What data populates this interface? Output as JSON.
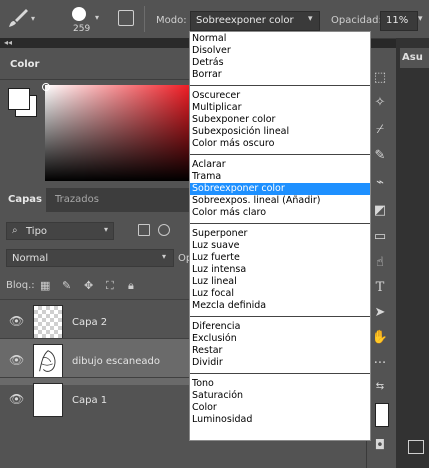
{
  "options_bar": {
    "brush_icon": "paintbrush-icon",
    "brush_size": "259",
    "mode_label": "Modo:",
    "mode_value": "Sobreexponer color",
    "opacity_label": "Opacidad:",
    "opacity_value": "11%"
  },
  "color_panel": {
    "tab": "Color",
    "foreground_color": "#ffffff",
    "background_color": "#ffffff",
    "picker_hue": "#f01a22"
  },
  "layers_panel": {
    "tabs": [
      "Capas",
      "Trazados"
    ],
    "filter_value": "Tipo",
    "blend_value": "Normal",
    "opacity_cut": "Op",
    "lock_label": "Bloq.:",
    "layers": [
      {
        "name": "Capa 2",
        "thumb": "transparent",
        "visible": true,
        "selected": false
      },
      {
        "name": "dibujo escaneado",
        "thumb": "sketch",
        "visible": true,
        "selected": true
      },
      {
        "name": "Capa 1",
        "thumb": "white",
        "visible": true,
        "selected": false
      }
    ]
  },
  "right_panel": {
    "tab": "Asu"
  },
  "blend_menu": {
    "selected": "Sobreexponer color",
    "groups": [
      [
        "Normal",
        "Disolver",
        "Detrás",
        "Borrar"
      ],
      [
        "Oscurecer",
        "Multiplicar",
        "Subexponer color",
        "Subexposición lineal",
        "Color más oscuro"
      ],
      [
        "Aclarar",
        "Trama",
        "Sobreexponer color",
        "Sobreexpos. lineal (Añadir)",
        "Color más claro"
      ],
      [
        "Superponer",
        "Luz suave",
        "Luz fuerte",
        "Luz intensa",
        "Luz lineal",
        "Luz focal",
        "Mezcla definida"
      ],
      [
        "Diferencia",
        "Exclusión",
        "Restar",
        "Dividir"
      ],
      [
        "Tono",
        "Saturación",
        "Color",
        "Luminosidad"
      ]
    ]
  }
}
